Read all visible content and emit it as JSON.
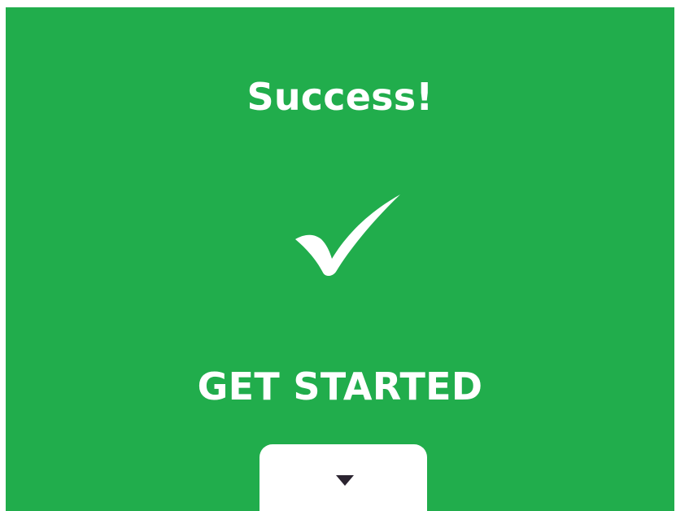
{
  "panel": {
    "background_color": "#21ad4c",
    "title": "Success!",
    "icon": "checkmark-icon",
    "cta_label": "GET STARTED",
    "expand_icon": "caret-down-icon"
  },
  "colors": {
    "text": "#ffffff",
    "tab_background": "#ffffff",
    "arrow": "#2b2430"
  }
}
